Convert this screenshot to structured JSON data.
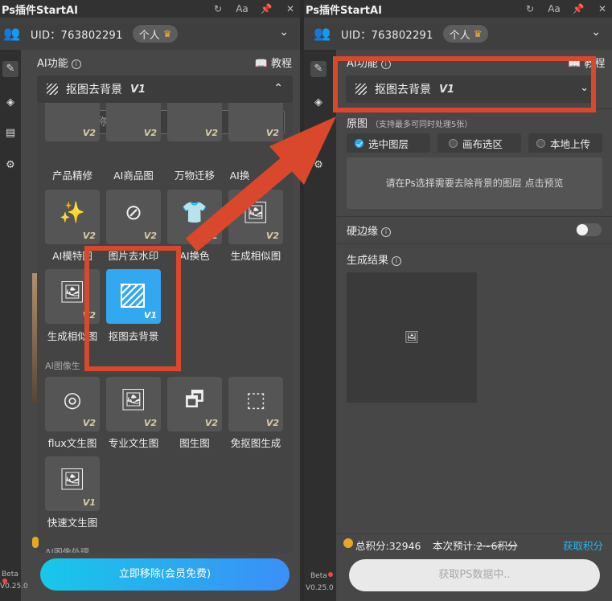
{
  "app": {
    "title": "Ps插件StartAI",
    "controls": [
      "↻",
      "Aa",
      "📌",
      "✕"
    ],
    "uid_label": "UID：763802291",
    "plan_badge": "个人",
    "crown_icon": "crown-icon",
    "beta": "Beta",
    "version": "V0.25.0"
  },
  "left": {
    "ai_title": "AI功能",
    "tutorial": "教程",
    "dropdown_label": "抠图去背景",
    "dropdown_version": "V1",
    "search_placeholder": "输入名称搜索",
    "row0": [
      {
        "label": "产品精修",
        "version": "V2"
      },
      {
        "label": "AI商品图",
        "version": "V2"
      },
      {
        "label": "万物迁移",
        "version": "V2"
      },
      {
        "label": "AI换",
        "version": "V2"
      }
    ],
    "row1": [
      {
        "label": "AI模特图",
        "version": "V2",
        "icon": "✨"
      },
      {
        "label": "图片去水印",
        "version": "V2",
        "icon": "⊘"
      },
      {
        "label": "AI换色",
        "version": "V2",
        "icon": "👕"
      },
      {
        "label": "生成相似图",
        "version": "V2",
        "icon": "🖼"
      }
    ],
    "row2": [
      {
        "label": "生成相似图",
        "version": "V2",
        "icon": "🖼"
      },
      {
        "label": "抠图去背景",
        "version": "V1",
        "icon": ""
      }
    ],
    "section_image_gen": "AI图像生",
    "row3": [
      {
        "label": "flux文生图",
        "version": "V2",
        "icon": "◎"
      },
      {
        "label": "专业文生图",
        "version": "V2",
        "icon": "🖼"
      },
      {
        "label": "图生图",
        "version": "V2",
        "icon": "🗗"
      },
      {
        "label": "免抠图生成",
        "version": "V2",
        "icon": "⬚"
      }
    ],
    "row4": [
      {
        "label": "快速文生图",
        "version": "V1",
        "icon": "🖼"
      }
    ],
    "section_image_proc": "AI图像处理",
    "main_button": "立即移除(会员免费)"
  },
  "right": {
    "ai_title": "AI功能",
    "tutorial": "教程",
    "dropdown_label": "抠图去背景",
    "dropdown_version": "V1",
    "source_title": "原图",
    "source_note": "（支持最多可同时处理5张）",
    "options": [
      "选中图层",
      "画布选区",
      "本地上传"
    ],
    "hint": "请在Ps选择需要去除背景的图层 点击预览",
    "hard_edge": "硬边缘",
    "result_title": "生成结果",
    "total_points": "总积分:32946",
    "estimate_prefix": "本次预计:",
    "estimate_value": "2~6积分",
    "get_points": "获取积分",
    "main_button": "获取PS数据中.."
  },
  "colors": {
    "accent": "#31a8ef",
    "annotation": "#d9472d",
    "coin": "#e6a821",
    "link": "#27b6f3"
  }
}
